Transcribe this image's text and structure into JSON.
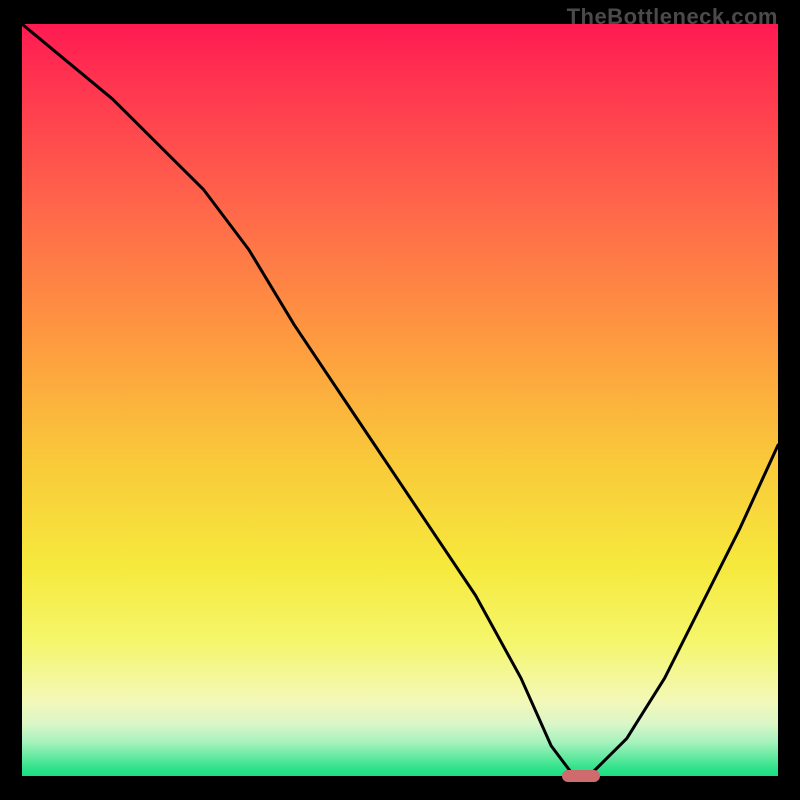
{
  "watermark": "TheBottleneck.com",
  "colors": {
    "page_bg": "#000000",
    "watermark": "#4a4a4a",
    "curve": "#000000",
    "marker": "#cf6b6d",
    "gradient_top": "#ff1a52",
    "gradient_bottom": "#18df82"
  },
  "chart_data": {
    "type": "line",
    "title": "",
    "xlabel": "",
    "ylabel": "",
    "xlim": [
      0,
      100
    ],
    "ylim": [
      0,
      100
    ],
    "grid": false,
    "series": [
      {
        "name": "curve",
        "x": [
          0,
          12,
          24,
          30,
          36,
          42,
          48,
          54,
          60,
          66,
          70,
          73,
          75,
          80,
          85,
          90,
          95,
          100
        ],
        "values": [
          100,
          90,
          78,
          70,
          60,
          51,
          42,
          33,
          24,
          13,
          4,
          0,
          0,
          5,
          13,
          23,
          33,
          44
        ]
      }
    ],
    "marker": {
      "x": 74,
      "y": 0,
      "color": "#cf6b6d"
    },
    "annotations": [
      {
        "text": "TheBottleneck.com",
        "position": "top-right"
      }
    ]
  }
}
